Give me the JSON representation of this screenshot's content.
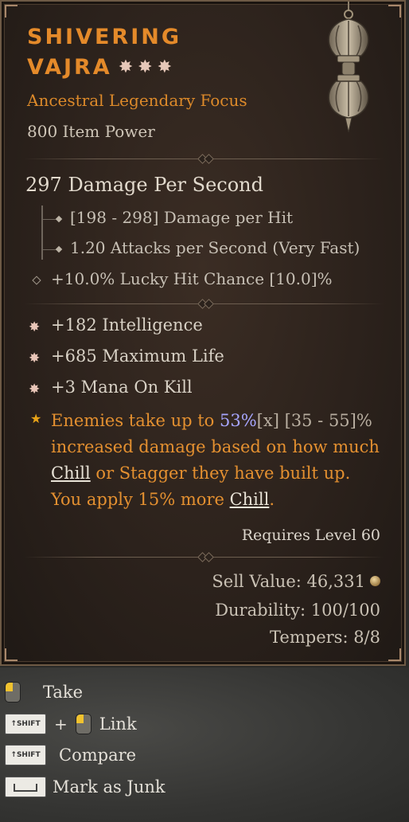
{
  "item": {
    "name_line1": "SHIVERING",
    "name_line2": "VAJRA",
    "rarity_type": "Ancestral Legendary Focus",
    "item_power": "800 Item Power",
    "dps": "297 Damage Per Second",
    "damage_per_hit": "[198 - 298] Damage per Hit",
    "attack_speed": "1.20 Attacks per Second (Very Fast)",
    "implicit": "+10.0% Lucky Hit Chance [10.0]%",
    "affixes": [
      "+182 Intelligence",
      "+685 Maximum Life",
      "+3 Mana On Kill"
    ],
    "legendary_power": {
      "pre": "Enemies take up to ",
      "value": "53%",
      "marker": "[x]",
      "range": " [35 - 55]%",
      "mid1": " increased damage based on how much ",
      "keyword1": "Chill",
      "mid2": " or Stagger they have built up. You apply 15% more ",
      "keyword2": "Chill",
      "end": "."
    },
    "requires_level": "Requires Level 60",
    "sell_value": "Sell Value: 46,331",
    "durability": "Durability: 100/100",
    "tempers": "Tempers: 8/8"
  },
  "controls": {
    "take": "Take",
    "link": "Link",
    "compare": "Compare",
    "junk": "Mark as Junk",
    "shift_key": "SHIFT"
  },
  "colors": {
    "legendary_orange": "#e48a2a",
    "value_blue": "#a7a6ff",
    "star_gold": "#e8a317"
  }
}
